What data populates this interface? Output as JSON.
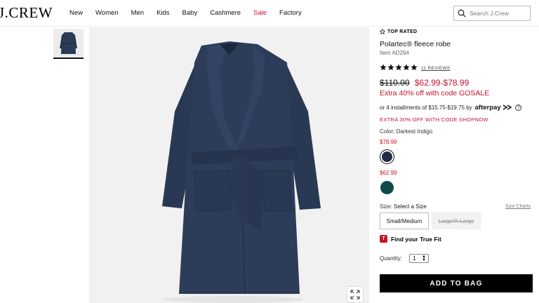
{
  "header": {
    "logo": "J.CREW",
    "nav": [
      "New",
      "Women",
      "Men",
      "Kids",
      "Baby",
      "Cashmere",
      "Sale",
      "Factory"
    ],
    "search_placeholder": "Search J.Crew"
  },
  "product": {
    "badge": "TOP RATED",
    "title": "Polartec® fleece robe",
    "item_number": "Item AD294",
    "rating_stars": 5,
    "reviews_label": "11 REVIEWS",
    "original_price": "$110.00",
    "sale_price": "$62.99-$78.99",
    "promo_line": "Extra 40% off with code GOSALE",
    "installments_text": "or 4 installments of $15.75-$19.75 by",
    "afterpay_label": "afterpay",
    "help_icon": "?",
    "promo_code_line": "EXTRA 30% OFF WITH CODE SHOPNOW",
    "color_label": "Color:",
    "color_value": "Darkest Indigo",
    "swatch_price_1": "$78.99",
    "swatch_price_2": "$62.99",
    "size_label": "Size:",
    "size_value": "Select a Size",
    "size_charts_label": "Size Charts",
    "sizes": [
      "Small/Medium",
      "Large/X-Large"
    ],
    "fit_icon_letter": "T",
    "fit_label": "Find your True Fit",
    "quantity_label": "Quantity:",
    "quantity_value": "1",
    "add_to_bag": "ADD TO BAG"
  },
  "colors": {
    "sale_red": "#c8102e",
    "swatch_indigo": "#1f2d45",
    "swatch_teal": "#0f4a48",
    "robe_navy": "#2b3a55"
  }
}
